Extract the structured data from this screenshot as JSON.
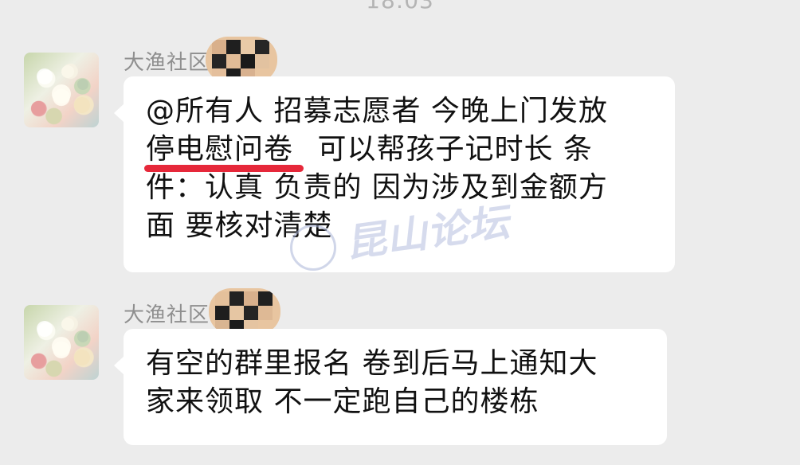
{
  "status_time": "18:03",
  "messages": [
    {
      "sender": "大渔社区",
      "lines": [
        "@所有人 招募志愿者 今晚上门发放",
        "可以帮孩子记时长 条",
        "件：认真 负责的 因为涉及到金额方",
        "面 要核对清楚"
      ],
      "underlined_phrase": "停电慰问卷"
    },
    {
      "sender": "大渔社区",
      "lines": [
        "有空的群里报名 卷到后马上通知大",
        "家来领取 不一定跑自己的楼栋"
      ]
    }
  ],
  "watermark": {
    "text": "昆山论坛"
  },
  "colors": {
    "background": "#ececec",
    "bubble": "#ffffff",
    "underline": "#e6283a",
    "sender_text": "#8f8f8f"
  }
}
